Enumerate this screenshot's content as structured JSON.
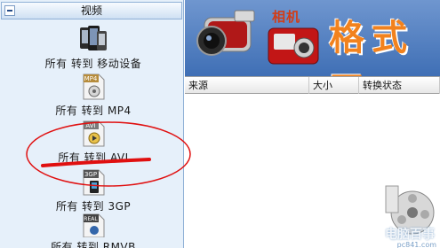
{
  "sidebar": {
    "header": "视频",
    "items": [
      {
        "label": "所有 转到 移动设备",
        "icon": "mobile-devices-icon"
      },
      {
        "label": "所有 转到 MP4",
        "icon": "mp4-file-icon",
        "icon_text": "MP4"
      },
      {
        "label": "所有 转到 AVI",
        "icon": "avi-file-icon",
        "icon_text": "AVI"
      },
      {
        "label": "所有 转到 3GP",
        "icon": "3gp-file-icon",
        "icon_text": "3GP"
      },
      {
        "label": "所有 转到 RMVB",
        "icon": "rmvb-file-icon",
        "icon_text": "REAL"
      }
    ]
  },
  "banner": {
    "label": "相机",
    "title": "格式工"
  },
  "table": {
    "columns": [
      "来源",
      "大小",
      "转换状态"
    ]
  },
  "watermark": {
    "text": "电脑百事",
    "sub": "pc841.com"
  },
  "colors": {
    "sidebar_bg": "#e6f0fa",
    "banner_bg": "#4f7fc1",
    "title_orange": "#f2821e",
    "annotation_red": "#e01010"
  }
}
